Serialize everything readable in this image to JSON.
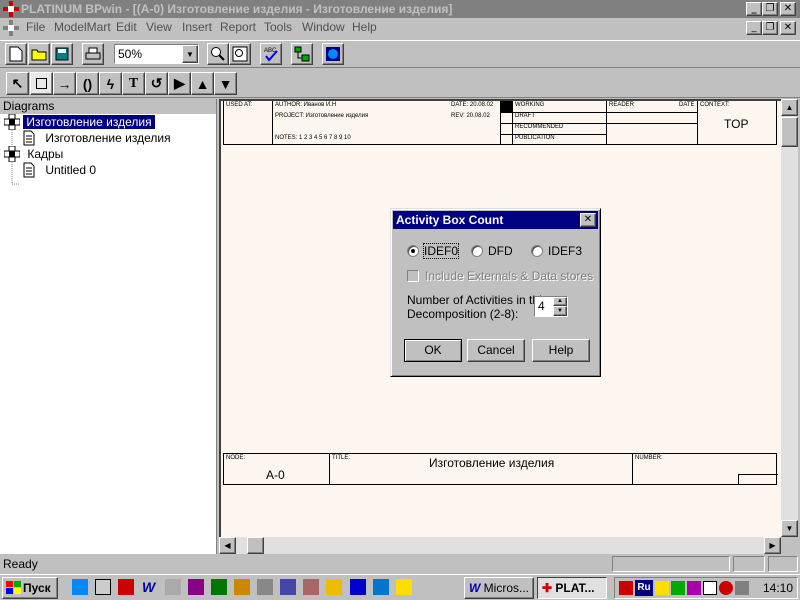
{
  "window": {
    "app_name": "PLATINUM BPwin",
    "title_rest": " - [(A-0) Изготовление изделия - Изготовление изделия]"
  },
  "menu": [
    "File",
    "ModelMart",
    "Edit",
    "View",
    "Insert",
    "Report",
    "Tools",
    "Window",
    "Help"
  ],
  "toolbar": {
    "zoom_value": "50%"
  },
  "drawtools": [
    "pointer-tool",
    "box-tool",
    "arrow-tool",
    "squiggle-tool",
    "lightning-tool",
    "text-tool",
    "rotate-tool",
    "next-level-tool",
    "up-level-tool",
    "down-level-tool"
  ],
  "tree": {
    "header": "Diagrams",
    "items": [
      {
        "label": "Изготовление изделия",
        "selected": true
      },
      {
        "label": "Изготовление изделия",
        "selected": false
      },
      {
        "label": "Кадры",
        "selected": false
      },
      {
        "label": "Untitled 0",
        "selected": false
      }
    ]
  },
  "frame": {
    "used_at": "USED AT:",
    "author": "AUTHOR: Иванов И.Н",
    "project": "PROJECT: Изготовление изделия",
    "notes": "NOTES: 1 2 3 4 5 6 7 8 9 10",
    "date": "DATE: 20.08.02",
    "rev": "REV: 20.08.02",
    "statuses": [
      "WORKING",
      "DRAFT",
      "RECOMMENDED",
      "PUBLICATION"
    ],
    "reader": "READER",
    "date2": "DATE",
    "context": "CONTEXT:",
    "context_value": "TOP",
    "node_label": "NODE:",
    "node_value": "A-0",
    "title_label": "TITLE:",
    "title_value": "Изготовление изделия",
    "number_label": "NUMBER:"
  },
  "dialog": {
    "title": "Activity Box Count",
    "close": "✕",
    "radios": [
      {
        "label": "IDEF0",
        "checked": true
      },
      {
        "label": "DFD",
        "checked": false
      },
      {
        "label": "IDEF3",
        "checked": false
      }
    ],
    "include_label": "Include Externals & Data stores",
    "count_label_1": "Number of Activities in this",
    "count_label_2": "Decomposition (2-8):",
    "count_value": "4",
    "ok": "OK",
    "cancel": "Cancel",
    "help": "Help"
  },
  "status": {
    "text": "Ready"
  },
  "taskbar": {
    "start": "Пуск",
    "tasks": [
      "Micros...",
      "PLAT..."
    ],
    "lang": "Ru",
    "clock": "14:10"
  }
}
